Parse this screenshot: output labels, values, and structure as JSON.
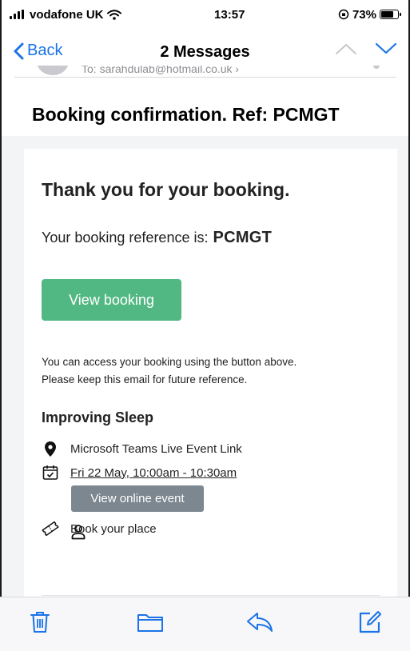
{
  "status_bar": {
    "carrier": "vodafone UK",
    "time": "13:57",
    "battery_text": "73%",
    "battery_level": 0.73
  },
  "nav": {
    "back_label": "Back",
    "title": "2 Messages"
  },
  "message": {
    "sender_partial": "To: sarahdulab@hotmail.co.uk ›",
    "subject": "Booking confirmation. Ref: PCMGT"
  },
  "email": {
    "heading": "Thank you for your booking.",
    "reference_label": "Your booking reference is:",
    "reference_code": "PCMGT",
    "view_booking_button": "View booking",
    "note_line1": "You can access your booking using the button above.",
    "note_line2": "Please keep this email for future reference.",
    "event_title": "Improving Sleep",
    "location": "Microsoft Teams Live Event Link",
    "datetime": "Fri 22 May, 10:00am - 10:30am",
    "view_online_button": "View online event",
    "book_place": "Book your place"
  },
  "colors": {
    "accent_blue": "#1a73e8",
    "view_booking_green": "#52b883",
    "online_button_gray": "#7d8790"
  },
  "toolbar_icons": [
    "trash-icon",
    "folder-icon",
    "reply-icon",
    "compose-icon"
  ]
}
